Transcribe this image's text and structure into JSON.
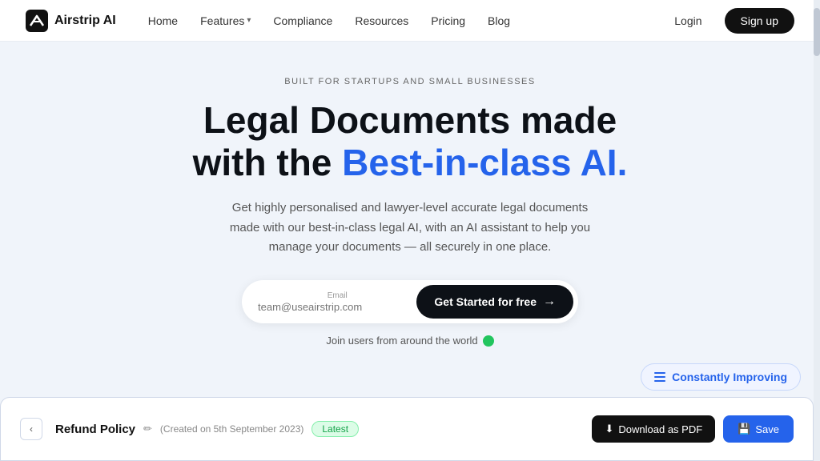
{
  "nav": {
    "logo_text": "Airstrip AI",
    "links": [
      {
        "label": "Home",
        "has_dropdown": false
      },
      {
        "label": "Features",
        "has_dropdown": true
      },
      {
        "label": "Compliance",
        "has_dropdown": false
      },
      {
        "label": "Resources",
        "has_dropdown": false
      },
      {
        "label": "Pricing",
        "has_dropdown": false
      },
      {
        "label": "Blog",
        "has_dropdown": false
      }
    ],
    "login_label": "Login",
    "signup_label": "Sign up"
  },
  "hero": {
    "eyebrow": "BUILT FOR STARTUPS AND SMALL BUSINESSES",
    "title_line1": "Legal Documents made",
    "title_line2": "with the ",
    "title_highlight": "Best-in-class AI.",
    "description": "Get highly personalised and lawyer-level accurate legal documents made with our best-in-class legal AI, with an AI assistant to help you manage your documents — all securely in one place.",
    "email_label": "Email",
    "email_placeholder": "team@useairstrip.com",
    "cta_label": "Get Started for free",
    "social_proof": "Join users from around the world"
  },
  "bottom_panel": {
    "doc_title": "Refund Policy",
    "doc_meta": "Created on 5th September 2023",
    "badge_label": "Latest",
    "download_label": "Download as PDF",
    "save_label": "Save"
  },
  "improving_badge": {
    "label": "Constantly Improving"
  }
}
